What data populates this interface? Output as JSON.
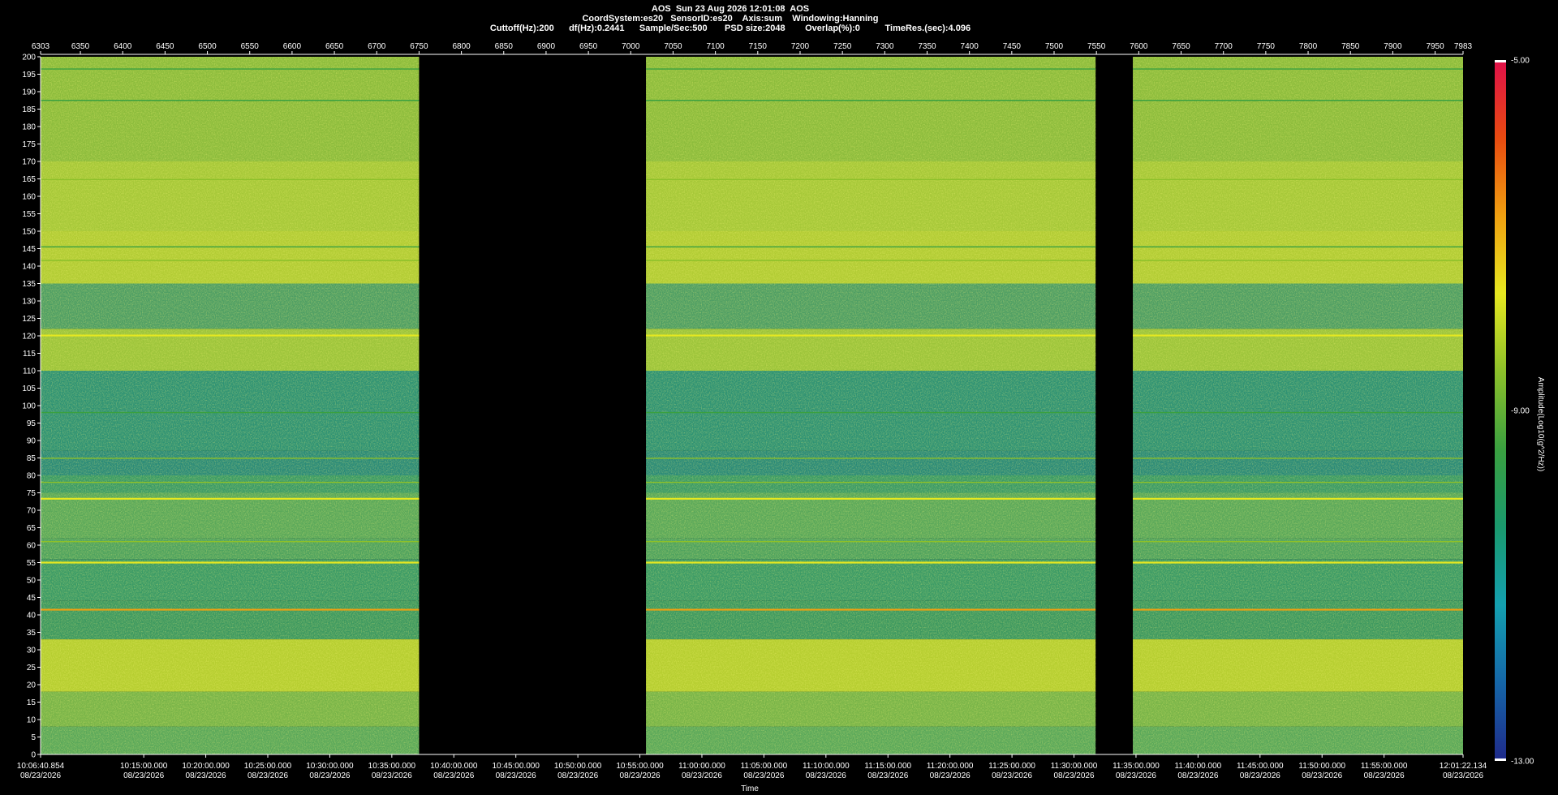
{
  "header": {
    "line1": "AOS  Sun 23 Aug 2026 12:01:08  AOS",
    "line2": "CoordSystem:es20   SensorID:es20    Axis:sum    Windowing:Hanning",
    "line3": "Cuttoff(Hz):200      df(Hz):0.2441      Sample/Sec:500       PSD size:2048        Overlap(%):0          TimeRes.(sec):4.096"
  },
  "chart_data": {
    "type": "heatmap",
    "title": "",
    "xlabel": "Time",
    "ylabel": "",
    "colorbar_label": "Amplitude(Log10(g^2/Hz))",
    "ylim": [
      0,
      200
    ],
    "y_ticks": [
      200,
      195,
      190,
      185,
      180,
      175,
      170,
      165,
      160,
      155,
      150,
      145,
      140,
      135,
      130,
      125,
      120,
      115,
      110,
      105,
      100,
      95,
      90,
      85,
      80,
      75,
      70,
      65,
      60,
      55,
      50,
      45,
      40,
      35,
      30,
      25,
      20,
      15,
      10,
      5,
      0
    ],
    "top_axis_range": [
      6303,
      7983
    ],
    "top_axis_ticks": [
      6303,
      6350,
      6400,
      6450,
      6500,
      6550,
      6600,
      6650,
      6700,
      6750,
      6800,
      6850,
      6900,
      6950,
      7000,
      7050,
      7100,
      7150,
      7200,
      7250,
      7300,
      7350,
      7400,
      7450,
      7500,
      7550,
      7600,
      7650,
      7700,
      7750,
      7800,
      7850,
      7900,
      7950,
      7983
    ],
    "time_ticks": [
      {
        "time": "10:06:40.854",
        "date": "08/23/2026"
      },
      {
        "time": "10:15:00.000",
        "date": "08/23/2026"
      },
      {
        "time": "10:20:00.000",
        "date": "08/23/2026"
      },
      {
        "time": "10:25:00.000",
        "date": "08/23/2026"
      },
      {
        "time": "10:30:00.000",
        "date": "08/23/2026"
      },
      {
        "time": "10:35:00.000",
        "date": "08/23/2026"
      },
      {
        "time": "10:40:00.000",
        "date": "08/23/2026"
      },
      {
        "time": "10:45:00.000",
        "date": "08/23/2026"
      },
      {
        "time": "10:50:00.000",
        "date": "08/23/2026"
      },
      {
        "time": "10:55:00.000",
        "date": "08/23/2026"
      },
      {
        "time": "11:00:00.000",
        "date": "08/23/2026"
      },
      {
        "time": "11:05:00.000",
        "date": "08/23/2026"
      },
      {
        "time": "11:10:00.000",
        "date": "08/23/2026"
      },
      {
        "time": "11:15:00.000",
        "date": "08/23/2026"
      },
      {
        "time": "11:20:00.000",
        "date": "08/23/2026"
      },
      {
        "time": "11:25:00.000",
        "date": "08/23/2026"
      },
      {
        "time": "11:30:00.000",
        "date": "08/23/2026"
      },
      {
        "time": "11:35:00.000",
        "date": "08/23/2026"
      },
      {
        "time": "11:40:00.000",
        "date": "08/23/2026"
      },
      {
        "time": "11:45:00.000",
        "date": "08/23/2026"
      },
      {
        "time": "11:50:00.000",
        "date": "08/23/2026"
      },
      {
        "time": "11:55:00.000",
        "date": "08/23/2026"
      },
      {
        "time": "12:01:22.134",
        "date": "08/23/2026"
      }
    ],
    "data_segments": [
      {
        "start": 6303,
        "end": 6750
      },
      {
        "start": 7018,
        "end": 7549
      },
      {
        "start": 7593,
        "end": 7983
      }
    ],
    "colorbar": {
      "min": -13.0,
      "max": -5.0,
      "labels": [
        "-5.00",
        "-9.00",
        "-13.00"
      ],
      "stops": [
        "#1f2a8a",
        "#1566a8",
        "#14a0b0",
        "#1a9a6e",
        "#3aa040",
        "#8cc02a",
        "#e6e820",
        "#f0a010",
        "#e84a10",
        "#e0104a"
      ]
    },
    "tonal_lines_hz": [
      {
        "freq": 196.5,
        "level": -9.6
      },
      {
        "freq": 187.5,
        "level": -9.5
      },
      {
        "freq": 164.8,
        "level": -8.3
      },
      {
        "freq": 145.5,
        "level": -9.3
      },
      {
        "freq": 141.6,
        "level": -8.5
      },
      {
        "freq": 120.1,
        "level": -7.9
      },
      {
        "freq": 98.0,
        "level": -9.6
      },
      {
        "freq": 84.9,
        "level": -8.5
      },
      {
        "freq": 78.0,
        "level": -8.4
      },
      {
        "freq": 73.3,
        "level": -7.9
      },
      {
        "freq": 61.0,
        "level": -9.0
      },
      {
        "freq": 55.0,
        "level": -7.4
      },
      {
        "freq": 41.5,
        "level": -6.6
      }
    ]
  }
}
